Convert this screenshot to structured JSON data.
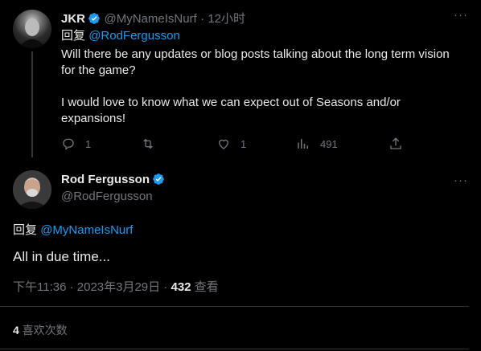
{
  "reply_tweet": {
    "display_name": "JKR",
    "handle": "@MyNameIsNurf",
    "time": "· 12小时",
    "reply_prefix": "回复",
    "reply_to": "@RodFergusson",
    "text_1": "Will there be any updates or blog posts talking about the long term vision for the game?",
    "text_2": "I would love to know what we can expect out of Seasons and/or expansions!",
    "actions": {
      "replies": "1",
      "retweets": "",
      "likes": "1",
      "views": "491"
    }
  },
  "main_tweet": {
    "display_name": "Rod Fergusson",
    "handle": "@RodFergusson",
    "reply_prefix": "回复",
    "reply_to": "@MyNameIsNurf",
    "text": "All in due time...",
    "timestamp": "下午11:36 · 2023年3月29日 · ",
    "views_count": "432",
    "views_label": " 查看",
    "likes_count": "4",
    "likes_label": " 喜欢次数"
  },
  "colors": {
    "background": "#000000",
    "text": "#e7e9ea",
    "muted": "#71767b",
    "accent": "#1d9bf0",
    "divider": "#2f3336"
  }
}
